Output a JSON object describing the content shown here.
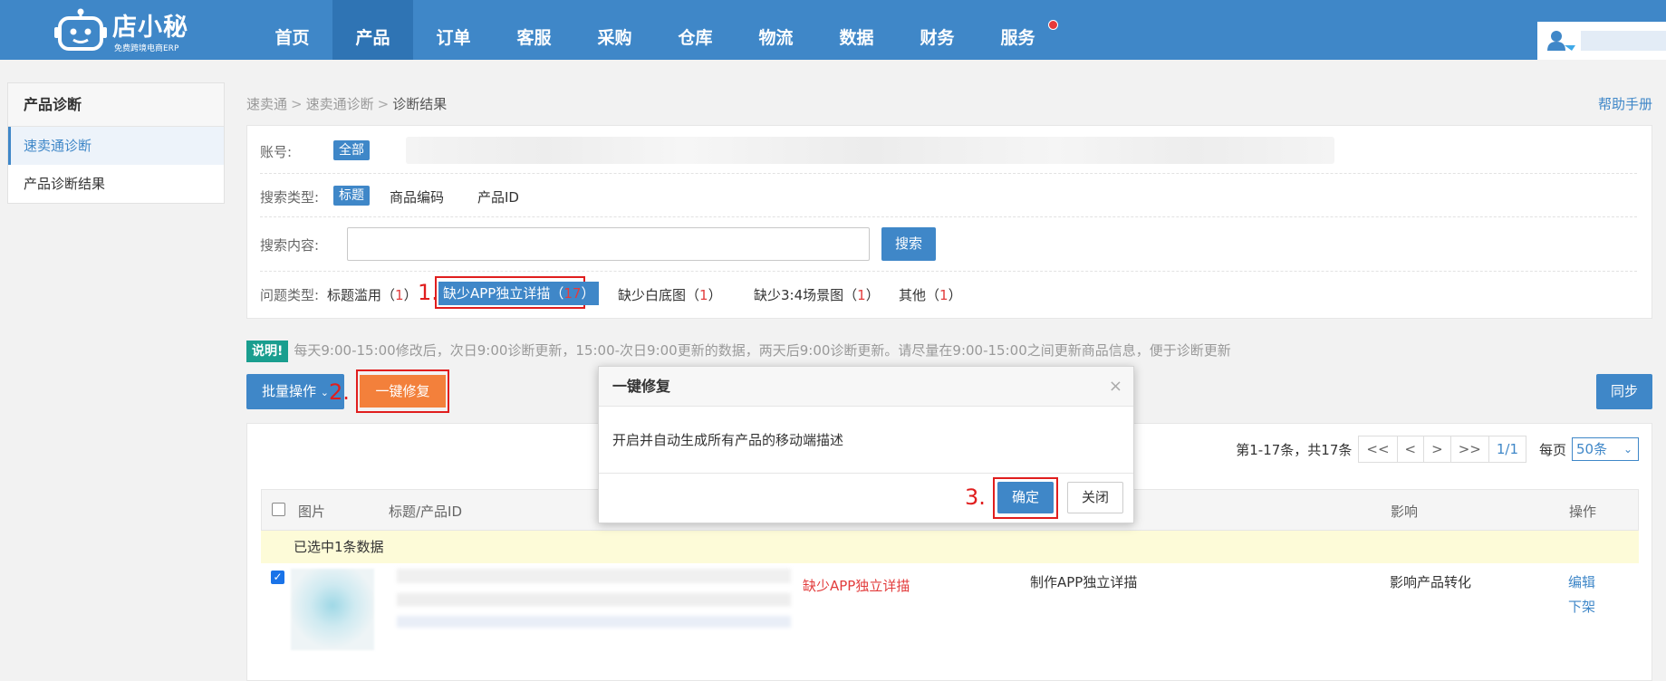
{
  "brand": {
    "name": "店小秘",
    "tagline": "免费跨境电商ERP"
  },
  "nav": [
    {
      "label": "首页",
      "active": false
    },
    {
      "label": "产品",
      "active": true
    },
    {
      "label": "订单",
      "active": false
    },
    {
      "label": "客服",
      "active": false
    },
    {
      "label": "采购",
      "active": false
    },
    {
      "label": "仓库",
      "active": false
    },
    {
      "label": "物流",
      "active": false
    },
    {
      "label": "数据",
      "active": false
    },
    {
      "label": "财务",
      "active": false
    },
    {
      "label": "服务",
      "active": false,
      "dot": true
    }
  ],
  "sidebar": {
    "title": "产品诊断",
    "items": [
      {
        "label": "速卖通诊断",
        "active": true
      },
      {
        "label": "产品诊断结果",
        "active": false
      }
    ]
  },
  "breadcrumb": [
    "速卖通",
    "速卖通诊断",
    "诊断结果"
  ],
  "help_label": "帮助手册",
  "filters": {
    "account_label": "账号:",
    "account_all": "全部",
    "search_type_label": "搜索类型:",
    "search_types": [
      "标题",
      "商品编码",
      "产品ID"
    ],
    "search_content_label": "搜索内容:",
    "search_value": "",
    "search_button": "搜索",
    "issue_type_label": "问题类型:",
    "issue_types": [
      {
        "label": "标题滥用",
        "count": "1"
      },
      {
        "label": "缺少APP独立详描",
        "count": "17"
      },
      {
        "label": "缺少白底图",
        "count": "1"
      },
      {
        "label": "缺少3:4场景图",
        "count": "1"
      },
      {
        "label": "其他",
        "count": "1"
      }
    ]
  },
  "notice": {
    "badge": "说明!",
    "text": "每天9:00-15:00修改后，次日9:00诊断更新，15:00-次日9:00更新的数据，两天后9:00诊断更新。请尽量在9:00-15:00之间更新商品信息，便于诊断更新"
  },
  "actions": {
    "batch": "批量操作",
    "fix": "一键修复",
    "sync": "同步"
  },
  "steps": [
    "1.",
    "2.",
    "3."
  ],
  "pager": {
    "summary": "第1-17条，共17条",
    "first": "<<",
    "prev": "<",
    "next": ">",
    "last": ">>",
    "page": "1/1",
    "per_page_label": "每页",
    "per_page_value": "50条"
  },
  "table": {
    "headers": {
      "image": "图片",
      "title": "标题/产品ID",
      "impact": "影响",
      "ops": "操作"
    },
    "selected_notice": "已选中1条数据",
    "rows": [
      {
        "issue": "缺少APP独立详描",
        "fix": "制作APP独立详描",
        "impact": "影响产品转化",
        "edit": "编辑",
        "offline": "下架",
        "checked": true
      }
    ]
  },
  "modal": {
    "title": "一键修复",
    "close": "×",
    "body": "开启并自动生成所有产品的移动端描述",
    "confirm": "确定",
    "cancel": "关闭"
  },
  "colors": {
    "primary": "#3f87c8",
    "orange": "#f3803b",
    "red": "#e01e1e",
    "teal": "#1a9e8f"
  }
}
